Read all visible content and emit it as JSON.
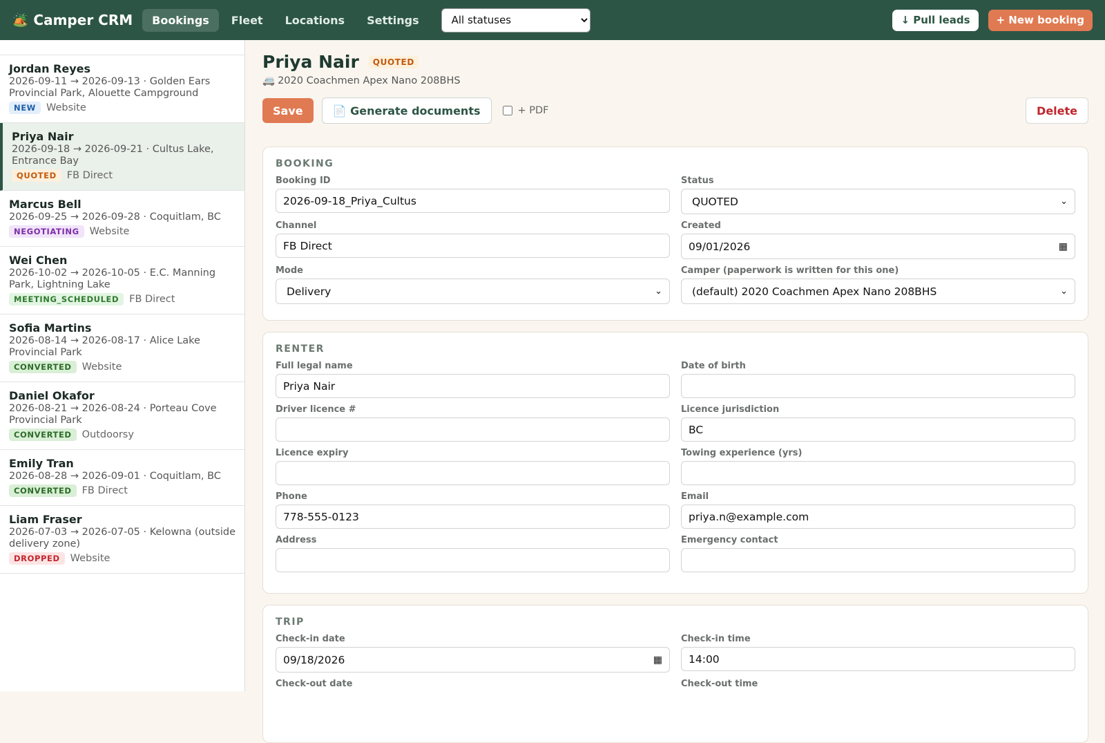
{
  "app": {
    "icon": "🏕️",
    "name": "Camper CRM",
    "nav": [
      {
        "label": "Bookings"
      },
      {
        "label": "Fleet"
      },
      {
        "label": "Locations"
      },
      {
        "label": "Settings"
      }
    ],
    "status_filter": "All statuses",
    "pull_leads_label": "↓ Pull leads",
    "new_booking_label": "+ New booking"
  },
  "bookings": [
    {
      "name": "Jordan Reyes",
      "details": "2026-09-11 → 2026-09-13 · Golden Ears Provincial Park, Alouette Campground",
      "status": "NEW",
      "channel": "Website"
    },
    {
      "name": "Priya Nair",
      "details": "2026-09-18 → 2026-09-21 · Cultus Lake, Entrance Bay",
      "status": "QUOTED",
      "channel": "FB Direct"
    },
    {
      "name": "Marcus Bell",
      "details": "2026-09-25 → 2026-09-28 · Coquitlam, BC",
      "status": "NEGOTIATING",
      "channel": "Website"
    },
    {
      "name": "Wei Chen",
      "details": "2026-10-02 → 2026-10-05 · E.C. Manning Park, Lightning Lake",
      "status": "MEETING_SCHEDULED",
      "channel": "FB Direct"
    },
    {
      "name": "Sofia Martins",
      "details": "2026-08-14 → 2026-08-17 · Alice Lake Provincial Park",
      "status": "CONVERTED",
      "channel": "Website"
    },
    {
      "name": "Daniel Okafor",
      "details": "2026-08-21 → 2026-08-24 · Porteau Cove Provincial Park",
      "status": "CONVERTED",
      "channel": "Outdoorsy"
    },
    {
      "name": "Emily Tran",
      "details": "2026-08-28 → 2026-09-01 · Coquitlam, BC",
      "status": "CONVERTED",
      "channel": "FB Direct"
    },
    {
      "name": "Liam Fraser",
      "details": "2026-07-03 → 2026-07-05 · Kelowna (outside delivery zone)",
      "status": "DROPPED",
      "channel": "Website"
    }
  ],
  "detail": {
    "title": "Priya Nair",
    "status_badge": "QUOTED",
    "camper_icon": "🚐",
    "camper": "2020 Coachmen Apex Nano 208BHS",
    "save_label": "Save",
    "generate_label": "📄 Generate documents",
    "pdf_label": "+ PDF",
    "delete_label": "Delete",
    "booking": {
      "title": "BOOKING",
      "booking_id_label": "Booking ID",
      "booking_id": "2026-09-18_Priya_Cultus",
      "status_label": "Status",
      "status": "QUOTED",
      "channel_label": "Channel",
      "channel": "FB Direct",
      "created_label": "Created",
      "created": "09/01/2026",
      "mode_label": "Mode",
      "mode": "Delivery",
      "camper_label": "Camper (paperwork is written for this one)",
      "camper": "(default) 2020 Coachmen Apex Nano 208BHS"
    },
    "renter": {
      "title": "RENTER",
      "full_name_label": "Full legal name",
      "full_name": "Priya Nair",
      "dob_label": "Date of birth",
      "dob": "",
      "licence_label": "Driver licence #",
      "licence": "",
      "jurisdiction_label": "Licence jurisdiction",
      "jurisdiction": "BC",
      "expiry_label": "Licence expiry",
      "expiry": "",
      "towing_label": "Towing experience (yrs)",
      "towing": "",
      "phone_label": "Phone",
      "phone": "778-555-0123",
      "email_label": "Email",
      "email": "priya.n@example.com",
      "address_label": "Address",
      "address": "",
      "emergency_label": "Emergency contact",
      "emergency": ""
    },
    "trip": {
      "title": "TRIP",
      "checkin_date_label": "Check-in date",
      "checkin_date": "09/18/2026",
      "checkin_time_label": "Check-in time",
      "checkin_time": "14:00",
      "checkout_date_label": "Check-out date",
      "checkout_time_label": "Check-out time"
    }
  }
}
